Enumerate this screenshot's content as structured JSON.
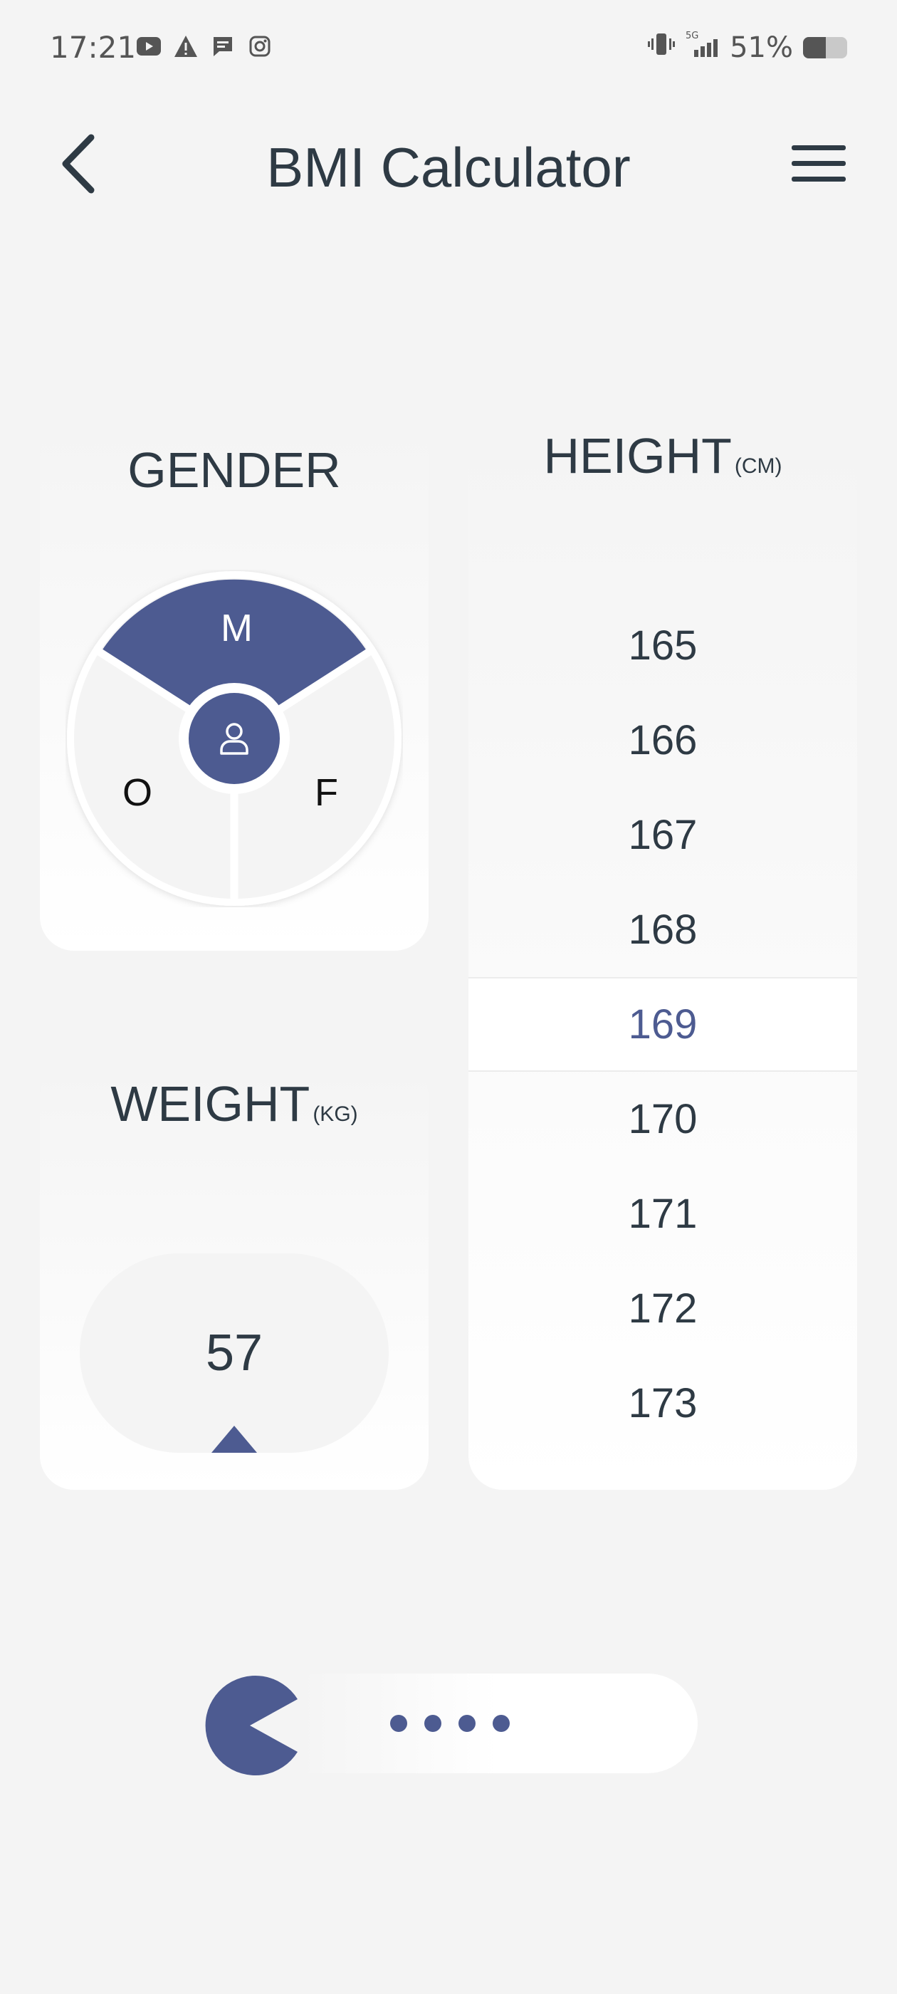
{
  "status_bar": {
    "time": "17:21",
    "battery_percent": "51%",
    "battery_level": 0.51,
    "network": "5G",
    "left_icons": [
      "youtube-icon",
      "warning-icon",
      "message-icon",
      "instagram-icon"
    ]
  },
  "header": {
    "title": "BMI Calculator"
  },
  "gender": {
    "title": "GENDER",
    "options": {
      "male": "M",
      "other": "O",
      "female": "F"
    },
    "selected": "M"
  },
  "height": {
    "title": "HEIGHT",
    "unit": "(CM)",
    "values": [
      "165",
      "166",
      "167",
      "168",
      "169",
      "170",
      "171",
      "172",
      "173"
    ],
    "selected": "169"
  },
  "weight": {
    "title": "WEIGHT",
    "unit": "(KG)",
    "value": "57"
  },
  "colors": {
    "accent": "#4d5b91",
    "text": "#2e3a44",
    "background": "#f4f4f4"
  }
}
